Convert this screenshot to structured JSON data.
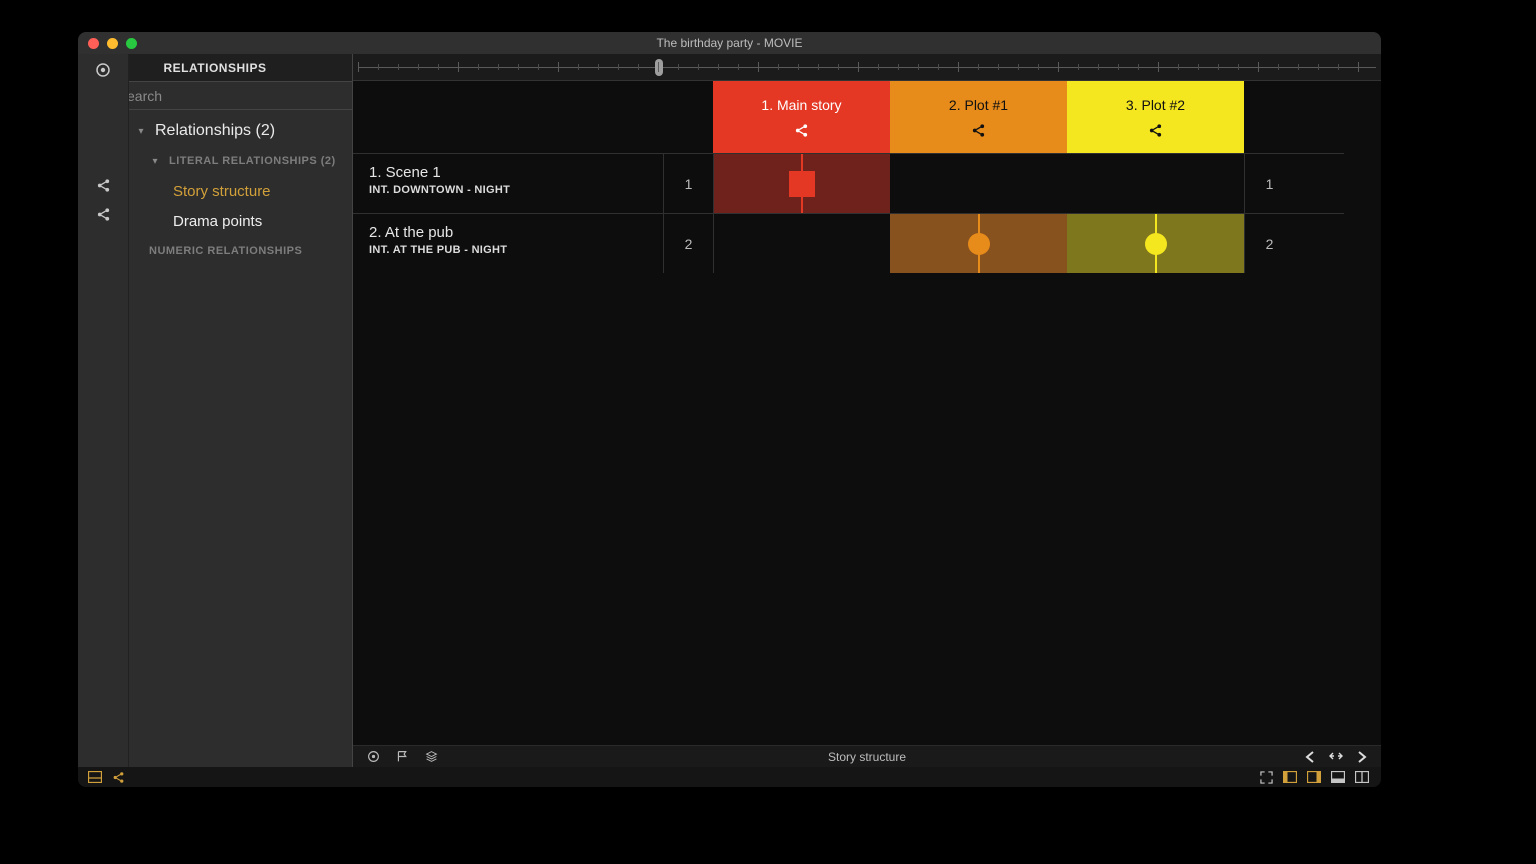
{
  "window": {
    "title": "The birthday party - MOVIE"
  },
  "sidebar": {
    "header": "RELATIONSHIPS",
    "search_placeholder": "search",
    "tree": {
      "root_label": "Relationships (2)",
      "group_literal": "LITERAL RELATIONSHIPS (2)",
      "item_story_structure": "Story structure",
      "item_drama_points": "Drama points",
      "group_numeric": "NUMERIC RELATIONSHIPS"
    }
  },
  "columns": {
    "plot1": {
      "label": "1. Main story"
    },
    "plot2": {
      "label": "2. Plot #1"
    },
    "plot3": {
      "label": "3. Plot #2"
    }
  },
  "scenes": [
    {
      "num": "1",
      "title": "1. Scene 1",
      "location": "INT.  DOWNTOWN - NIGHT",
      "right_num": "1"
    },
    {
      "num": "2",
      "title": "2. At the pub",
      "location": "INT.  AT THE PUB - NIGHT",
      "right_num": "2"
    }
  ],
  "footer": {
    "view_name": "Story structure"
  }
}
